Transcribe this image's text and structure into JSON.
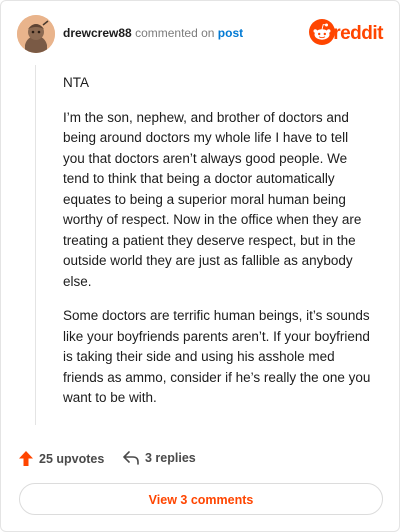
{
  "comment": {
    "username": "drewcrew88",
    "action_text": "commented on",
    "post_link": "post",
    "paragraphs": [
      "NTA",
      "I’m the son, nephew, and brother of doctors and being around doctors my whole life I have to tell you that doctors aren’t always good people. We tend to think that being a doctor automatically equates to being a superior moral human being worthy of respect. Now in the office when they are treating a patient they deserve respect, but in the outside world they are just as fallible as anybody else.",
      "Some doctors are terrific human beings, it’s sounds like your boyfriends parents aren’t. If your boyfriend is taking their side and using his asshole med friends as ammo, consider if he’s really the one you want to be with."
    ],
    "upvotes_label": "25 upvotes",
    "replies_label": "3 replies",
    "view_comments_label": "View 3 comments"
  },
  "brand": {
    "wordmark": "reddit",
    "color": "#ff4500"
  },
  "icons": {
    "upvote": "upvote-arrow-icon",
    "reply": "reply-arrow-icon",
    "logo": "reddit-snoo-icon",
    "avatar": "user-avatar"
  }
}
